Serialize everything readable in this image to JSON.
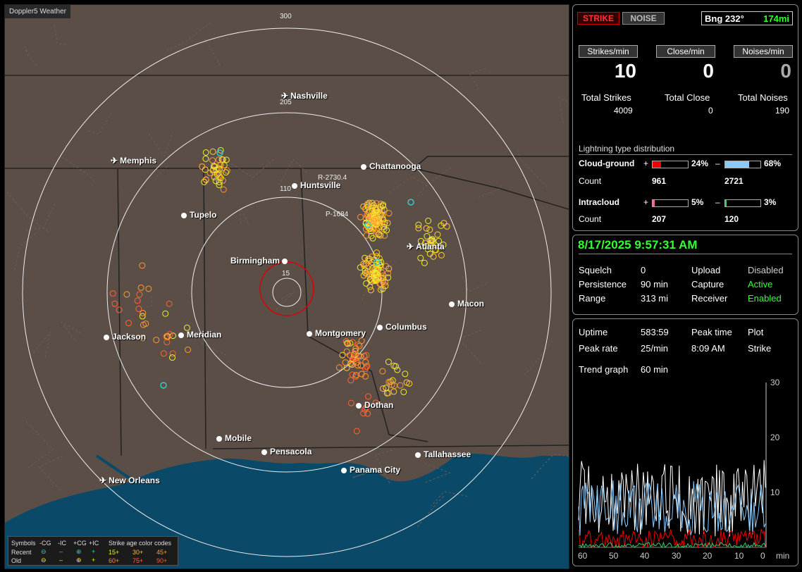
{
  "app": {
    "title": "Doppler5 Weather"
  },
  "map": {
    "ring_labels": {
      "outer": "300",
      "r205": "205",
      "r110": "110",
      "r15": "15"
    },
    "cities": [
      {
        "name": "Nashville",
        "type": "airport"
      },
      {
        "name": "Memphis",
        "type": "airport"
      },
      {
        "name": "Chattanooga",
        "type": "city"
      },
      {
        "name": "Huntsville",
        "type": "city"
      },
      {
        "name": "Tupelo",
        "type": "city"
      },
      {
        "name": "Birmingham",
        "type": "city"
      },
      {
        "name": "Atlanta",
        "type": "airport"
      },
      {
        "name": "Macon",
        "type": "city"
      },
      {
        "name": "Jackson",
        "type": "city"
      },
      {
        "name": "Meridian",
        "type": "city"
      },
      {
        "name": "Montgomery",
        "type": "city"
      },
      {
        "name": "Columbus",
        "type": "city"
      },
      {
        "name": "Dothan",
        "type": "city"
      },
      {
        "name": "Mobile",
        "type": "city"
      },
      {
        "name": "Pensacola",
        "type": "city"
      },
      {
        "name": "Tallahassee",
        "type": "city"
      },
      {
        "name": "Panama City",
        "type": "city"
      },
      {
        "name": "New Orleans",
        "type": "airport"
      }
    ],
    "radials": {
      "r1": "R-2730.4",
      "p1": "P-1684"
    },
    "legend": {
      "symbols_label": "Symbols",
      "col_cg_neg": "-CG",
      "col_ic_neg": "-IC",
      "col_cg_pos": "+CG",
      "col_ic_pos": "+IC",
      "age_title": "Strike age color codes",
      "recent_label": "Recent",
      "old_label": "Old",
      "ages_recent": [
        "15+",
        "30+",
        "45+"
      ],
      "ages_old": [
        "60+",
        "75+",
        "90+"
      ]
    }
  },
  "status": {
    "strike_btn": "STRIKE",
    "noise_btn": "NOISE",
    "bearing": "Bng 232°",
    "distance": "174mi",
    "strikes_min_label": "Strikes/min",
    "close_min_label": "Close/min",
    "noises_min_label": "Noises/min",
    "strikes_min": "10",
    "close_min": "0",
    "noises_min": "0",
    "total_strikes_label": "Total Strikes",
    "total_close_label": "Total Close",
    "total_noises_label": "Total Noises",
    "total_strikes": "4009",
    "total_close": "0",
    "total_noises": "190",
    "dist_title": "Lightning type distribution",
    "cg_label": "Cloud-ground",
    "ic_label": "Intracloud",
    "count_label": "Count",
    "plus": "+",
    "minus": "–",
    "cg_pos_pct": "24%",
    "cg_neg_pct": "68%",
    "cg_pos_count": "961",
    "cg_neg_count": "2721",
    "ic_pos_pct": "5%",
    "ic_neg_pct": "3%",
    "ic_pos_count": "207",
    "ic_neg_count": "120",
    "cg_pos_frac": 0.24,
    "cg_neg_frac": 0.68,
    "ic_pos_frac": 0.05,
    "ic_neg_frac": 0.03
  },
  "info": {
    "datetime": "8/17/2025 9:57:31 AM",
    "squelch_label": "Squelch",
    "squelch": "0",
    "upload_label": "Upload",
    "upload": "Disabled",
    "persistence_label": "Persistence",
    "persistence": "90 min",
    "capture_label": "Capture",
    "capture": "Active",
    "range_label": "Range",
    "range": "313 mi",
    "receiver_label": "Receiver",
    "receiver": "Enabled"
  },
  "stats": {
    "uptime_label": "Uptime",
    "uptime": "583:59",
    "peak_time_label": "Peak time",
    "plot_label": "Plot",
    "peak_rate_label": "Peak rate",
    "peak_rate": "25/min",
    "peak_time": "8:09 AM",
    "plot": "Strike",
    "trend_label": "Trend graph",
    "trend": "60 min",
    "y_ticks": [
      "30",
      "20",
      "10"
    ],
    "x_ticks": [
      "60",
      "50",
      "40",
      "30",
      "20",
      "10",
      "0"
    ],
    "x_unit": "min"
  },
  "colors": {
    "strike_red": "#c00",
    "cg_pos": "#e00",
    "cg_neg": "#8cf",
    "ic_pos": "#e6a",
    "ic_neg": "#3c6",
    "accent_green": "#3f3"
  }
}
